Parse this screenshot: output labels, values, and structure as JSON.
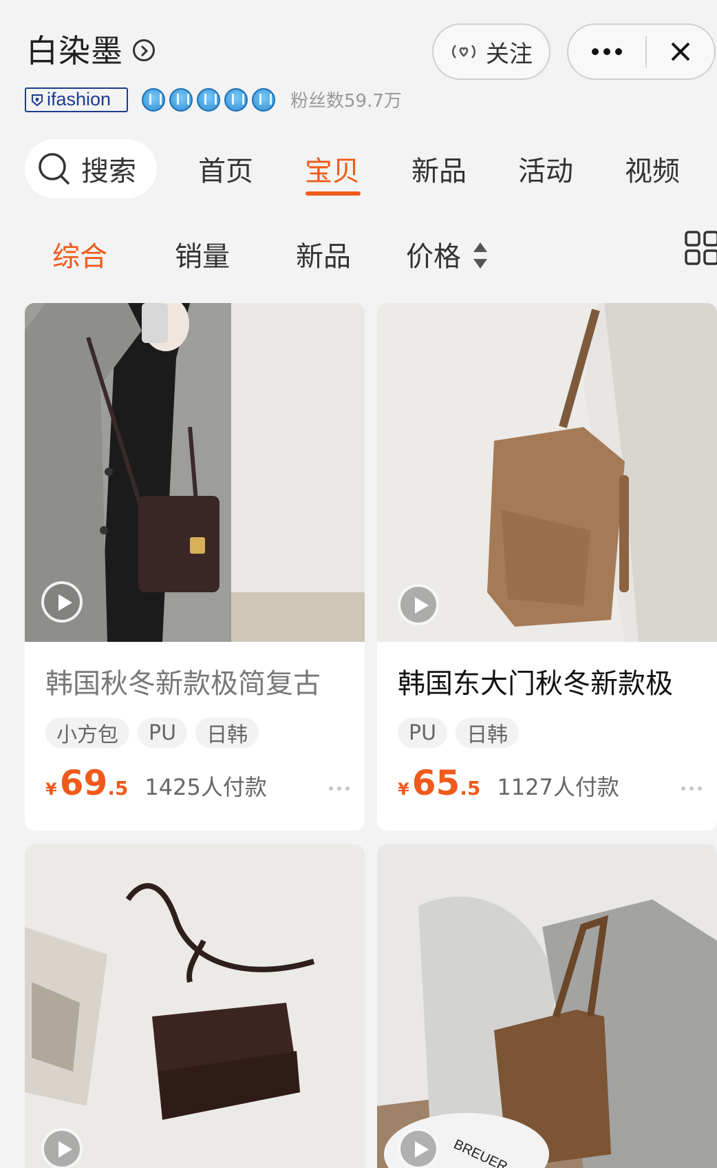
{
  "header": {
    "shop_name": "白染墨",
    "follow_label": "关注",
    "fans_text": "粉丝数59.7万",
    "brand_badge": "ifashion"
  },
  "nav": {
    "search_label": "搜索",
    "tabs": [
      "首页",
      "宝贝",
      "新品",
      "活动",
      "视频"
    ],
    "active_tab": "宝贝"
  },
  "sort": {
    "items": [
      "综合",
      "销量",
      "新品",
      "价格"
    ],
    "active": "综合"
  },
  "products": [
    {
      "title": "韩国秋冬新款极简复古",
      "tags": [
        "小方包",
        "PU",
        "日韩"
      ],
      "currency": "¥",
      "price_int": "69",
      "price_dec": ".5",
      "paid": "1425人付款"
    },
    {
      "title": "韩国东大门秋冬新款极",
      "tags": [
        "PU",
        "日韩"
      ],
      "currency": "¥",
      "price_int": "65",
      "price_dec": ".5",
      "paid": "1127人付款"
    }
  ],
  "colors": {
    "accent": "#f05a1a",
    "background": "#f3f3f3"
  }
}
